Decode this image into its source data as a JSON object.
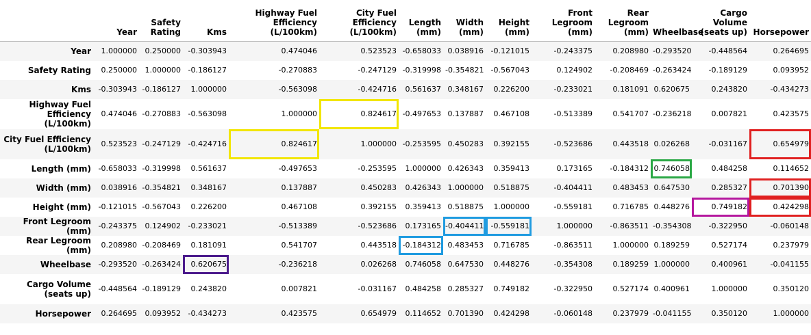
{
  "columns": [
    "Year",
    "Safety Rating",
    "Kms",
    "Highway Fuel Efficiency (L/100km)",
    "City Fuel Efficiency (L/100km)",
    "Length (mm)",
    "Width (mm)",
    "Height (mm)",
    "Front Legroom (mm)",
    "Rear Legroom (mm)",
    "Wheelbase",
    "Cargo Volume (seats up)",
    "Horsepower"
  ],
  "rows": [
    {
      "label": "Year",
      "values": [
        "1.000000",
        "0.250000",
        "-0.303943",
        "0.474046",
        "0.523523",
        "-0.658033",
        "0.038916",
        "-0.121015",
        "-0.243375",
        "0.208980",
        "-0.293520",
        "-0.448564",
        "0.264695"
      ]
    },
    {
      "label": "Safety Rating",
      "values": [
        "0.250000",
        "1.000000",
        "-0.186127",
        "-0.270883",
        "-0.247129",
        "-0.319998",
        "-0.354821",
        "-0.567043",
        "0.124902",
        "-0.208469",
        "-0.263424",
        "-0.189129",
        "0.093952"
      ]
    },
    {
      "label": "Kms",
      "values": [
        "-0.303943",
        "-0.186127",
        "1.000000",
        "-0.563098",
        "-0.424716",
        "0.561637",
        "0.348167",
        "0.226200",
        "-0.233021",
        "0.181091",
        "0.620675",
        "0.243820",
        "-0.434273"
      ]
    },
    {
      "label": "Highway Fuel Efficiency (L/100km)",
      "values": [
        "0.474046",
        "-0.270883",
        "-0.563098",
        "1.000000",
        "0.824617",
        "-0.497653",
        "0.137887",
        "0.467108",
        "-0.513389",
        "0.541707",
        "-0.236218",
        "0.007821",
        "0.423575"
      ]
    },
    {
      "label": "City Fuel Efficiency (L/100km)",
      "values": [
        "0.523523",
        "-0.247129",
        "-0.424716",
        "0.824617",
        "1.000000",
        "-0.253595",
        "0.450283",
        "0.392155",
        "-0.523686",
        "0.443518",
        "0.026268",
        "-0.031167",
        "0.654979"
      ]
    },
    {
      "label": "Length (mm)",
      "values": [
        "-0.658033",
        "-0.319998",
        "0.561637",
        "-0.497653",
        "-0.253595",
        "1.000000",
        "0.426343",
        "0.359413",
        "0.173165",
        "-0.184312",
        "0.746058",
        "0.484258",
        "0.114652"
      ]
    },
    {
      "label": "Width (mm)",
      "values": [
        "0.038916",
        "-0.354821",
        "0.348167",
        "0.137887",
        "0.450283",
        "0.426343",
        "1.000000",
        "0.518875",
        "-0.404411",
        "0.483453",
        "0.647530",
        "0.285327",
        "0.701390"
      ]
    },
    {
      "label": "Height (mm)",
      "values": [
        "-0.121015",
        "-0.567043",
        "0.226200",
        "0.467108",
        "0.392155",
        "0.359413",
        "0.518875",
        "1.000000",
        "-0.559181",
        "0.716785",
        "0.448276",
        "0.749182",
        "0.424298"
      ]
    },
    {
      "label": "Front Legroom (mm)",
      "values": [
        "-0.243375",
        "0.124902",
        "-0.233021",
        "-0.513389",
        "-0.523686",
        "0.173165",
        "-0.404411",
        "-0.559181",
        "1.000000",
        "-0.863511",
        "-0.354308",
        "-0.322950",
        "-0.060148"
      ]
    },
    {
      "label": "Rear Legroom (mm)",
      "values": [
        "0.208980",
        "-0.208469",
        "0.181091",
        "0.541707",
        "0.443518",
        "-0.184312",
        "0.483453",
        "0.716785",
        "-0.863511",
        "1.000000",
        "0.189259",
        "0.527174",
        "0.237979"
      ]
    },
    {
      "label": "Wheelbase",
      "values": [
        "-0.293520",
        "-0.263424",
        "0.620675",
        "-0.236218",
        "0.026268",
        "0.746058",
        "0.647530",
        "0.448276",
        "-0.354308",
        "0.189259",
        "1.000000",
        "0.400961",
        "-0.041155"
      ]
    },
    {
      "label": "Cargo Volume (seats up)",
      "values": [
        "-0.448564",
        "-0.189129",
        "0.243820",
        "0.007821",
        "-0.031167",
        "0.484258",
        "0.285327",
        "0.749182",
        "-0.322950",
        "0.527174",
        "0.400961",
        "1.000000",
        "0.350120"
      ]
    },
    {
      "label": "Horsepower",
      "values": [
        "0.264695",
        "0.093952",
        "-0.434273",
        "0.423575",
        "0.654979",
        "0.114652",
        "0.701390",
        "0.424298",
        "-0.060148",
        "0.237979",
        "-0.041155",
        "0.350120",
        "1.000000"
      ]
    }
  ],
  "highlights": [
    {
      "row": 3,
      "col": 4,
      "color": "#f2e600"
    },
    {
      "row": 4,
      "col": 3,
      "color": "#f2e600"
    },
    {
      "row": 4,
      "col": 12,
      "color": "#e02020"
    },
    {
      "row": 5,
      "col": 10,
      "color": "#2aa845"
    },
    {
      "row": 6,
      "col": 12,
      "color": "#e02020"
    },
    {
      "row": 7,
      "col": 11,
      "color": "#b5179e"
    },
    {
      "row": 7,
      "col": 12,
      "color": "#e02020"
    },
    {
      "row": 8,
      "col": 6,
      "color": "#1f9be0"
    },
    {
      "row": 8,
      "col": 7,
      "color": "#1f9be0"
    },
    {
      "row": 9,
      "col": 5,
      "color": "#1f9be0"
    },
    {
      "row": 10,
      "col": 2,
      "color": "#4b1a8c"
    }
  ]
}
